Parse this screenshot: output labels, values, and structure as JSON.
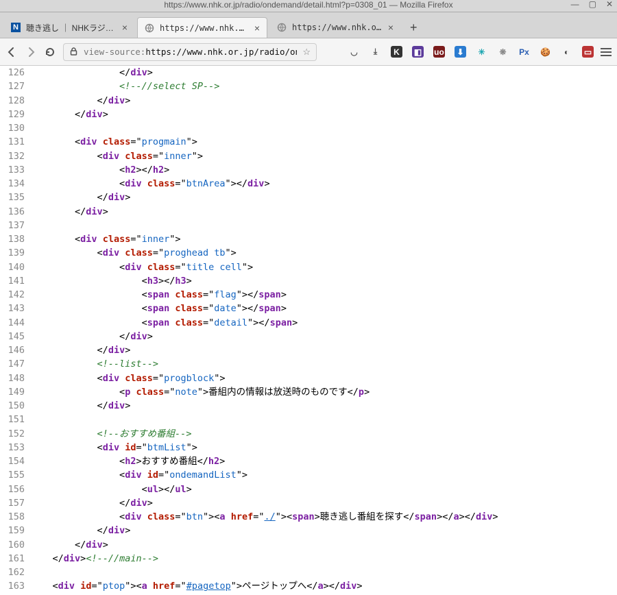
{
  "window": {
    "title": "https://www.nhk.or.jp/radio/ondemand/detail.html?p=0308_01 — Mozilla Firefox"
  },
  "tabs": [
    {
      "label": "聴き逃し ｜ NHKラジオ らじ",
      "favicon_letter": "N",
      "favicon_bg": "#0b52a0",
      "favicon_fg": "#ffffff",
      "active": false
    },
    {
      "label": "https://www.nhk.or.jp/radio/",
      "favicon_letter": "",
      "favicon_bg": "transparent",
      "favicon_fg": "#555",
      "active": true
    },
    {
      "label": "https://www.nhk.or.jp/radio/",
      "favicon_letter": "",
      "favicon_bg": "transparent",
      "favicon_fg": "#555",
      "active": false
    }
  ],
  "url": {
    "prefix": "view-source:",
    "rest": "https://www.nhk.or.jp/radio/ondemand/det"
  },
  "icons": [
    {
      "name": "pocket-icon",
      "bg": "transparent",
      "fg": "#555",
      "text": "◡"
    },
    {
      "name": "downloads-icon",
      "bg": "transparent",
      "fg": "#555",
      "text": "⤓"
    },
    {
      "name": "ext-k-icon",
      "bg": "#333",
      "fg": "#fff",
      "text": "K"
    },
    {
      "name": "ext-purple-icon",
      "bg": "#5c3b9b",
      "fg": "#fff",
      "text": "◧"
    },
    {
      "name": "ublock-icon",
      "bg": "#7a1b1b",
      "fg": "#fff",
      "text": "uo"
    },
    {
      "name": "ext-dl-icon",
      "bg": "#2a7bd0",
      "fg": "#fff",
      "text": "⬇"
    },
    {
      "name": "ext-teal-icon",
      "bg": "transparent",
      "fg": "#1aa5b0",
      "text": "✳"
    },
    {
      "name": "ext-grey-icon",
      "bg": "transparent",
      "fg": "#8a8a8a",
      "text": "❋"
    },
    {
      "name": "ext-px-icon",
      "bg": "transparent",
      "fg": "#2b5fb3",
      "text": "Px"
    },
    {
      "name": "ext-cookie-icon",
      "bg": "transparent",
      "fg": "#6b4a2f",
      "text": "🍪"
    },
    {
      "name": "ext-circle-icon",
      "bg": "transparent",
      "fg": "#444",
      "text": "◐"
    },
    {
      "name": "ext-doc-icon",
      "bg": "#b33",
      "fg": "#fff",
      "text": "▭"
    }
  ],
  "lines": {
    "start": 126,
    "end": 163
  },
  "source": {
    "l126": {
      "indent": 16,
      "frag": [
        {
          "t": "punct",
          "v": "</"
        },
        {
          "t": "tag",
          "v": "div"
        },
        {
          "t": "punct",
          "v": ">"
        }
      ]
    },
    "l127": {
      "indent": 16,
      "frag": [
        {
          "t": "cmt",
          "v": "<!--//select SP-->"
        }
      ]
    },
    "l128": {
      "indent": 12,
      "frag": [
        {
          "t": "punct",
          "v": "</"
        },
        {
          "t": "tag",
          "v": "div"
        },
        {
          "t": "punct",
          "v": ">"
        }
      ]
    },
    "l129": {
      "indent": 8,
      "frag": [
        {
          "t": "punct",
          "v": "</"
        },
        {
          "t": "tag",
          "v": "div"
        },
        {
          "t": "punct",
          "v": ">"
        }
      ]
    },
    "l130": {
      "indent": 0,
      "frag": []
    },
    "l131": {
      "indent": 8,
      "frag": [
        {
          "t": "punct",
          "v": "<"
        },
        {
          "t": "tag",
          "v": "div"
        },
        {
          "t": "txt",
          "v": " "
        },
        {
          "t": "attr",
          "v": "class"
        },
        {
          "t": "punct",
          "v": "=\""
        },
        {
          "t": "val",
          "v": "progmain"
        },
        {
          "t": "punct",
          "v": "\">"
        }
      ]
    },
    "l132": {
      "indent": 12,
      "frag": [
        {
          "t": "punct",
          "v": "<"
        },
        {
          "t": "tag",
          "v": "div"
        },
        {
          "t": "txt",
          "v": " "
        },
        {
          "t": "attr",
          "v": "class"
        },
        {
          "t": "punct",
          "v": "=\""
        },
        {
          "t": "val",
          "v": "inner"
        },
        {
          "t": "punct",
          "v": "\">"
        }
      ]
    },
    "l133": {
      "indent": 16,
      "frag": [
        {
          "t": "punct",
          "v": "<"
        },
        {
          "t": "tag",
          "v": "h2"
        },
        {
          "t": "punct",
          "v": "></"
        },
        {
          "t": "tag",
          "v": "h2"
        },
        {
          "t": "punct",
          "v": ">"
        }
      ]
    },
    "l134": {
      "indent": 16,
      "frag": [
        {
          "t": "punct",
          "v": "<"
        },
        {
          "t": "tag",
          "v": "div"
        },
        {
          "t": "txt",
          "v": " "
        },
        {
          "t": "attr",
          "v": "class"
        },
        {
          "t": "punct",
          "v": "=\""
        },
        {
          "t": "val",
          "v": "btnArea"
        },
        {
          "t": "punct",
          "v": "\"></"
        },
        {
          "t": "tag",
          "v": "div"
        },
        {
          "t": "punct",
          "v": ">"
        }
      ]
    },
    "l135": {
      "indent": 12,
      "frag": [
        {
          "t": "punct",
          "v": "</"
        },
        {
          "t": "tag",
          "v": "div"
        },
        {
          "t": "punct",
          "v": ">"
        }
      ]
    },
    "l136": {
      "indent": 8,
      "frag": [
        {
          "t": "punct",
          "v": "</"
        },
        {
          "t": "tag",
          "v": "div"
        },
        {
          "t": "punct",
          "v": ">"
        }
      ]
    },
    "l137": {
      "indent": 0,
      "frag": []
    },
    "l138": {
      "indent": 8,
      "frag": [
        {
          "t": "punct",
          "v": "<"
        },
        {
          "t": "tag",
          "v": "div"
        },
        {
          "t": "txt",
          "v": " "
        },
        {
          "t": "attr",
          "v": "class"
        },
        {
          "t": "punct",
          "v": "=\""
        },
        {
          "t": "val",
          "v": "inner"
        },
        {
          "t": "punct",
          "v": "\">"
        }
      ]
    },
    "l139": {
      "indent": 12,
      "frag": [
        {
          "t": "punct",
          "v": "<"
        },
        {
          "t": "tag",
          "v": "div"
        },
        {
          "t": "txt",
          "v": " "
        },
        {
          "t": "attr",
          "v": "class"
        },
        {
          "t": "punct",
          "v": "=\""
        },
        {
          "t": "val",
          "v": "proghead tb"
        },
        {
          "t": "punct",
          "v": "\">"
        }
      ]
    },
    "l140": {
      "indent": 16,
      "frag": [
        {
          "t": "punct",
          "v": "<"
        },
        {
          "t": "tag",
          "v": "div"
        },
        {
          "t": "txt",
          "v": " "
        },
        {
          "t": "attr",
          "v": "class"
        },
        {
          "t": "punct",
          "v": "=\""
        },
        {
          "t": "val",
          "v": "title cell"
        },
        {
          "t": "punct",
          "v": "\">"
        }
      ]
    },
    "l141": {
      "indent": 20,
      "frag": [
        {
          "t": "punct",
          "v": "<"
        },
        {
          "t": "tag",
          "v": "h3"
        },
        {
          "t": "punct",
          "v": "></"
        },
        {
          "t": "tag",
          "v": "h3"
        },
        {
          "t": "punct",
          "v": ">"
        }
      ]
    },
    "l142": {
      "indent": 20,
      "frag": [
        {
          "t": "punct",
          "v": "<"
        },
        {
          "t": "tag",
          "v": "span"
        },
        {
          "t": "txt",
          "v": " "
        },
        {
          "t": "attr",
          "v": "class"
        },
        {
          "t": "punct",
          "v": "=\""
        },
        {
          "t": "val",
          "v": "flag"
        },
        {
          "t": "punct",
          "v": "\"></"
        },
        {
          "t": "tag",
          "v": "span"
        },
        {
          "t": "punct",
          "v": ">"
        }
      ]
    },
    "l143": {
      "indent": 20,
      "frag": [
        {
          "t": "punct",
          "v": "<"
        },
        {
          "t": "tag",
          "v": "span"
        },
        {
          "t": "txt",
          "v": " "
        },
        {
          "t": "attr",
          "v": "class"
        },
        {
          "t": "punct",
          "v": "=\""
        },
        {
          "t": "val",
          "v": "date"
        },
        {
          "t": "punct",
          "v": "\"></"
        },
        {
          "t": "tag",
          "v": "span"
        },
        {
          "t": "punct",
          "v": ">"
        }
      ]
    },
    "l144": {
      "indent": 20,
      "frag": [
        {
          "t": "punct",
          "v": "<"
        },
        {
          "t": "tag",
          "v": "span"
        },
        {
          "t": "txt",
          "v": " "
        },
        {
          "t": "attr",
          "v": "class"
        },
        {
          "t": "punct",
          "v": "=\""
        },
        {
          "t": "val",
          "v": "detail"
        },
        {
          "t": "punct",
          "v": "\"></"
        },
        {
          "t": "tag",
          "v": "span"
        },
        {
          "t": "punct",
          "v": ">"
        }
      ]
    },
    "l145": {
      "indent": 16,
      "frag": [
        {
          "t": "punct",
          "v": "</"
        },
        {
          "t": "tag",
          "v": "div"
        },
        {
          "t": "punct",
          "v": ">"
        }
      ]
    },
    "l146": {
      "indent": 12,
      "frag": [
        {
          "t": "punct",
          "v": "</"
        },
        {
          "t": "tag",
          "v": "div"
        },
        {
          "t": "punct",
          "v": ">"
        }
      ]
    },
    "l147": {
      "indent": 12,
      "frag": [
        {
          "t": "cmt",
          "v": "<!--list-->"
        }
      ]
    },
    "l148": {
      "indent": 12,
      "frag": [
        {
          "t": "punct",
          "v": "<"
        },
        {
          "t": "tag",
          "v": "div"
        },
        {
          "t": "txt",
          "v": " "
        },
        {
          "t": "attr",
          "v": "class"
        },
        {
          "t": "punct",
          "v": "=\""
        },
        {
          "t": "val",
          "v": "progblock"
        },
        {
          "t": "punct",
          "v": "\">"
        }
      ]
    },
    "l149": {
      "indent": 16,
      "frag": [
        {
          "t": "punct",
          "v": "<"
        },
        {
          "t": "tag",
          "v": "p"
        },
        {
          "t": "txt",
          "v": " "
        },
        {
          "t": "attr",
          "v": "class"
        },
        {
          "t": "punct",
          "v": "=\""
        },
        {
          "t": "val",
          "v": "note"
        },
        {
          "t": "punct",
          "v": "\">"
        },
        {
          "t": "txt",
          "v": "番組内の情報は放送時のものです"
        },
        {
          "t": "punct",
          "v": "</"
        },
        {
          "t": "tag",
          "v": "p"
        },
        {
          "t": "punct",
          "v": ">"
        }
      ]
    },
    "l150": {
      "indent": 12,
      "frag": [
        {
          "t": "punct",
          "v": "</"
        },
        {
          "t": "tag",
          "v": "div"
        },
        {
          "t": "punct",
          "v": ">"
        }
      ]
    },
    "l151": {
      "indent": 0,
      "frag": []
    },
    "l152": {
      "indent": 12,
      "frag": [
        {
          "t": "cmt",
          "v": "<!--おすすめ番組-->"
        }
      ]
    },
    "l153": {
      "indent": 12,
      "frag": [
        {
          "t": "punct",
          "v": "<"
        },
        {
          "t": "tag",
          "v": "div"
        },
        {
          "t": "txt",
          "v": " "
        },
        {
          "t": "attr",
          "v": "id"
        },
        {
          "t": "punct",
          "v": "=\""
        },
        {
          "t": "val",
          "v": "btmList"
        },
        {
          "t": "punct",
          "v": "\">"
        }
      ]
    },
    "l154": {
      "indent": 16,
      "frag": [
        {
          "t": "punct",
          "v": "<"
        },
        {
          "t": "tag",
          "v": "h2"
        },
        {
          "t": "punct",
          "v": ">"
        },
        {
          "t": "txt",
          "v": "おすすめ番組"
        },
        {
          "t": "punct",
          "v": "</"
        },
        {
          "t": "tag",
          "v": "h2"
        },
        {
          "t": "punct",
          "v": ">"
        }
      ]
    },
    "l155": {
      "indent": 16,
      "frag": [
        {
          "t": "punct",
          "v": "<"
        },
        {
          "t": "tag",
          "v": "div"
        },
        {
          "t": "txt",
          "v": " "
        },
        {
          "t": "attr",
          "v": "id"
        },
        {
          "t": "punct",
          "v": "=\""
        },
        {
          "t": "val",
          "v": "ondemandList"
        },
        {
          "t": "punct",
          "v": "\">"
        }
      ]
    },
    "l156": {
      "indent": 20,
      "frag": [
        {
          "t": "punct",
          "v": "<"
        },
        {
          "t": "tag",
          "v": "ul"
        },
        {
          "t": "punct",
          "v": "></"
        },
        {
          "t": "tag",
          "v": "ul"
        },
        {
          "t": "punct",
          "v": ">"
        }
      ]
    },
    "l157": {
      "indent": 16,
      "frag": [
        {
          "t": "punct",
          "v": "</"
        },
        {
          "t": "tag",
          "v": "div"
        },
        {
          "t": "punct",
          "v": ">"
        }
      ]
    },
    "l158": {
      "indent": 16,
      "frag": [
        {
          "t": "punct",
          "v": "<"
        },
        {
          "t": "tag",
          "v": "div"
        },
        {
          "t": "txt",
          "v": " "
        },
        {
          "t": "attr",
          "v": "class"
        },
        {
          "t": "punct",
          "v": "=\""
        },
        {
          "t": "val",
          "v": "btn"
        },
        {
          "t": "punct",
          "v": "\"><"
        },
        {
          "t": "tag",
          "v": "a"
        },
        {
          "t": "txt",
          "v": " "
        },
        {
          "t": "attr",
          "v": "href"
        },
        {
          "t": "punct",
          "v": "=\""
        },
        {
          "t": "link",
          "v": "./"
        },
        {
          "t": "punct",
          "v": "\"><"
        },
        {
          "t": "tag",
          "v": "span"
        },
        {
          "t": "punct",
          "v": ">"
        },
        {
          "t": "txt",
          "v": "聴き逃し番組を探す"
        },
        {
          "t": "punct",
          "v": "</"
        },
        {
          "t": "tag",
          "v": "span"
        },
        {
          "t": "punct",
          "v": "></"
        },
        {
          "t": "tag",
          "v": "a"
        },
        {
          "t": "punct",
          "v": "></"
        },
        {
          "t": "tag",
          "v": "div"
        },
        {
          "t": "punct",
          "v": ">"
        }
      ]
    },
    "l159": {
      "indent": 12,
      "frag": [
        {
          "t": "punct",
          "v": "</"
        },
        {
          "t": "tag",
          "v": "div"
        },
        {
          "t": "punct",
          "v": ">"
        }
      ]
    },
    "l160": {
      "indent": 8,
      "frag": [
        {
          "t": "punct",
          "v": "</"
        },
        {
          "t": "tag",
          "v": "div"
        },
        {
          "t": "punct",
          "v": ">"
        }
      ]
    },
    "l161": {
      "indent": 4,
      "frag": [
        {
          "t": "punct",
          "v": "</"
        },
        {
          "t": "tag",
          "v": "div"
        },
        {
          "t": "punct",
          "v": ">"
        },
        {
          "t": "cmt",
          "v": "<!--//main-->"
        }
      ]
    },
    "l162": {
      "indent": 0,
      "frag": []
    },
    "l163": {
      "indent": 4,
      "frag": [
        {
          "t": "punct",
          "v": "<"
        },
        {
          "t": "tag",
          "v": "div"
        },
        {
          "t": "txt",
          "v": " "
        },
        {
          "t": "attr",
          "v": "id"
        },
        {
          "t": "punct",
          "v": "=\""
        },
        {
          "t": "val",
          "v": "ptop"
        },
        {
          "t": "punct",
          "v": "\"><"
        },
        {
          "t": "tag",
          "v": "a"
        },
        {
          "t": "txt",
          "v": " "
        },
        {
          "t": "attr",
          "v": "href"
        },
        {
          "t": "punct",
          "v": "=\""
        },
        {
          "t": "link",
          "v": "#pagetop"
        },
        {
          "t": "punct",
          "v": "\">"
        },
        {
          "t": "txt",
          "v": "ページトップへ"
        },
        {
          "t": "punct",
          "v": "</"
        },
        {
          "t": "tag",
          "v": "a"
        },
        {
          "t": "punct",
          "v": "></"
        },
        {
          "t": "tag",
          "v": "div"
        },
        {
          "t": "punct",
          "v": ">"
        }
      ]
    }
  }
}
